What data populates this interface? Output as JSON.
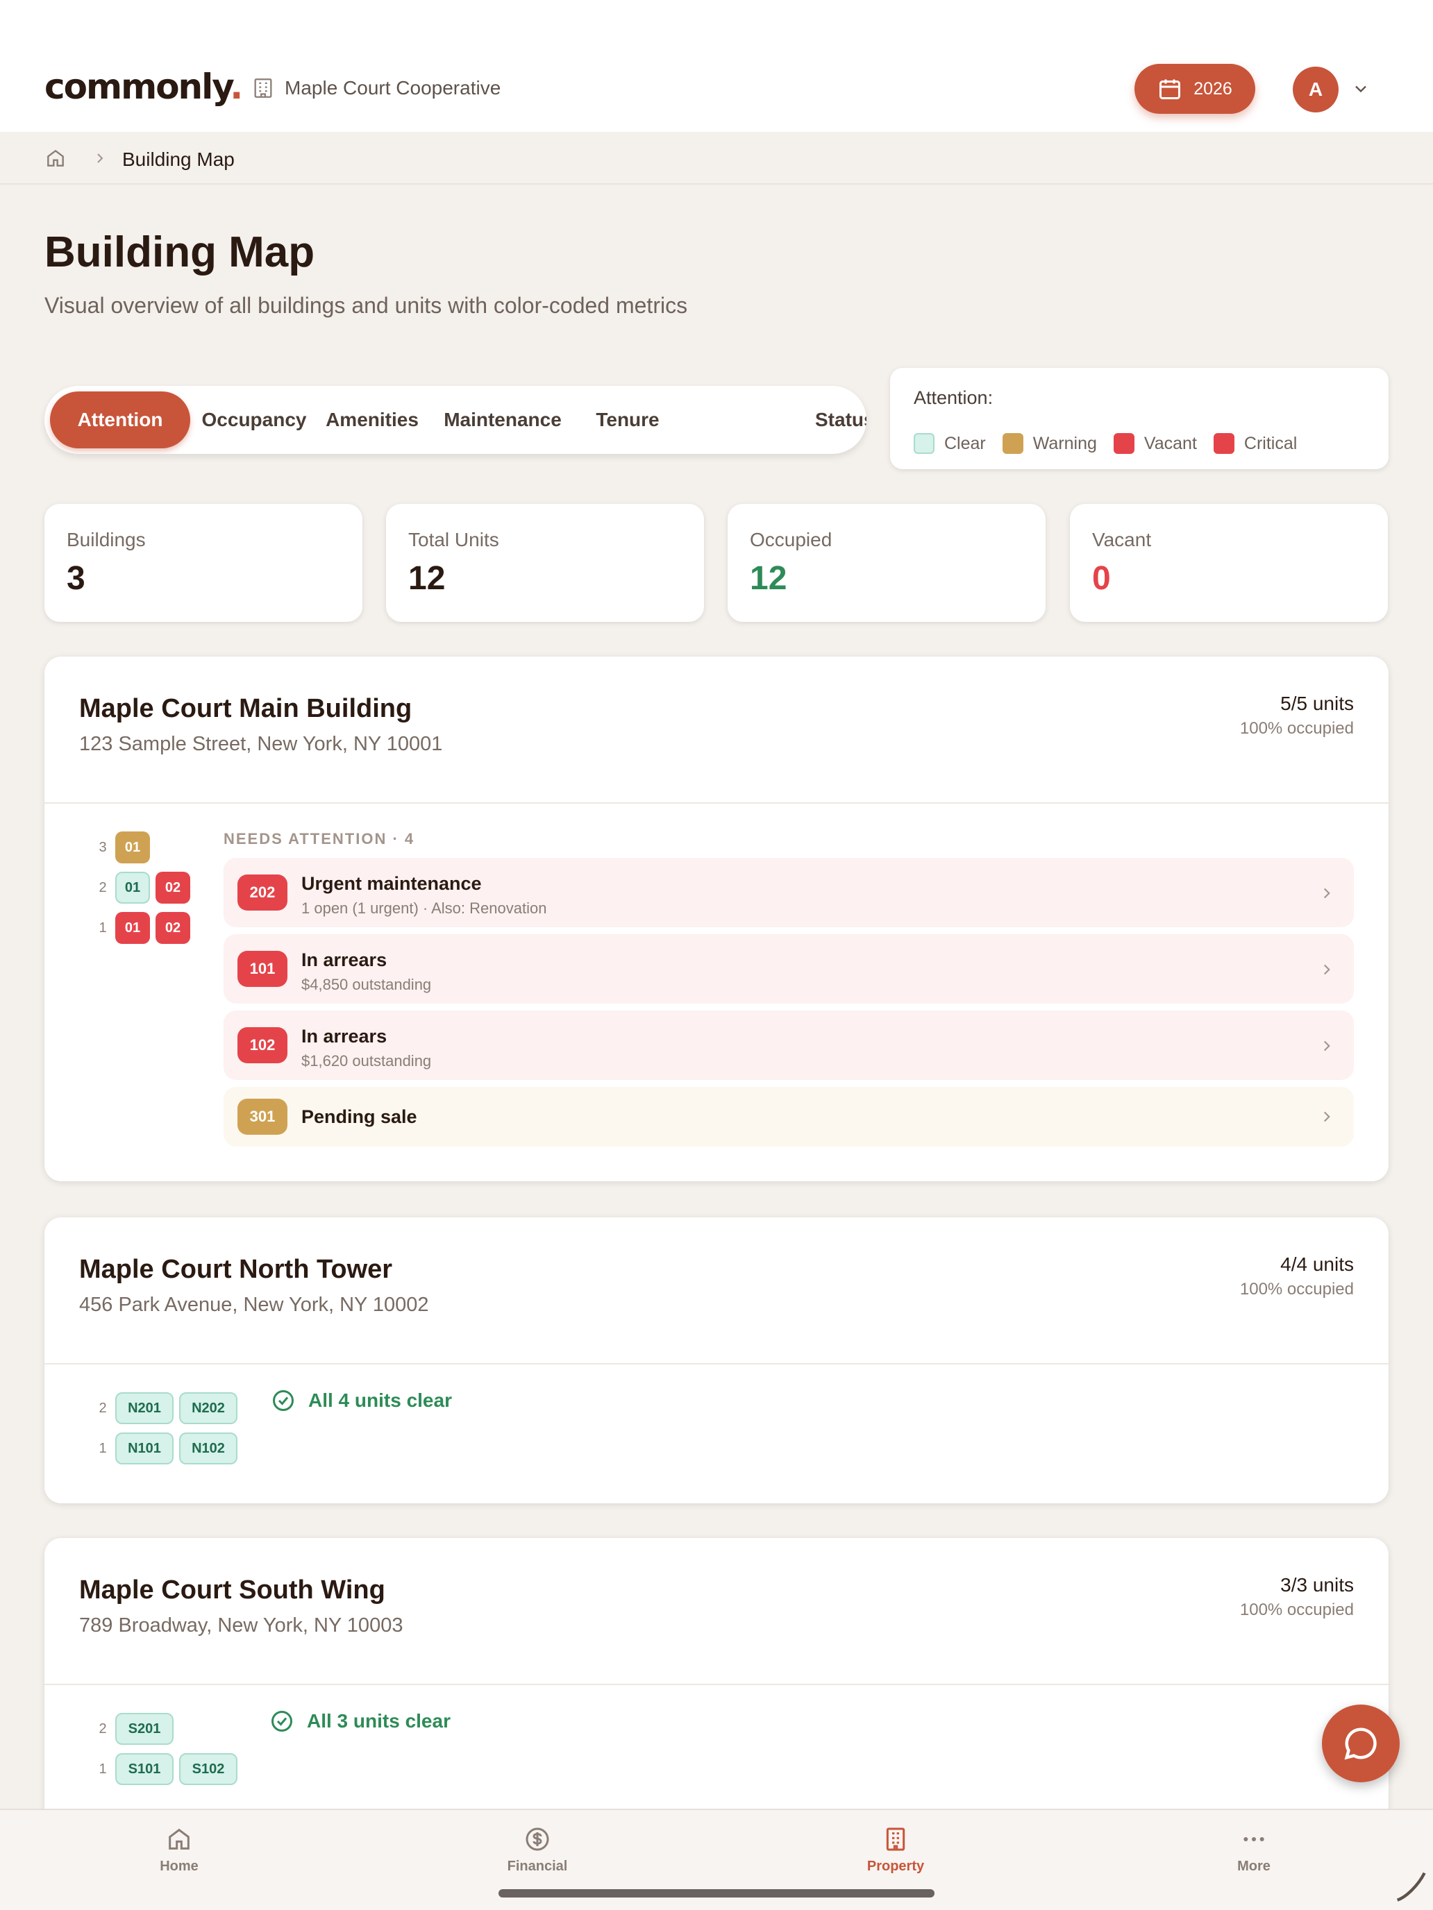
{
  "header": {
    "logo_text": "commonly",
    "logo_dot": ".",
    "org_name": "Maple Court Cooperative",
    "year_button": "2026",
    "avatar_initial": "A",
    "brand_color": "#c8553a"
  },
  "breadcrumb": {
    "current": "Building Map"
  },
  "page": {
    "title": "Building Map",
    "subtitle": "Visual overview of all buildings and units with color-coded metrics"
  },
  "tabs": [
    "Attention",
    "Occupancy",
    "Amenities",
    "Maintenance",
    "Tenure",
    "Status"
  ],
  "active_tab": "Attention",
  "legend": {
    "title": "Attention:",
    "items": [
      {
        "label": "Clear",
        "color": "#d6f2ea"
      },
      {
        "label": "Warning",
        "color": "#cfa253"
      },
      {
        "label": "Vacant",
        "color": "#e5434a"
      },
      {
        "label": "Critical",
        "color": "#e5434a"
      }
    ]
  },
  "stats": [
    {
      "label": "Buildings",
      "value": "3",
      "color": "#2a1a12"
    },
    {
      "label": "Total Units",
      "value": "12",
      "color": "#2a1a12"
    },
    {
      "label": "Occupied",
      "value": "12",
      "color": "#2e8b57"
    },
    {
      "label": "Vacant",
      "value": "0",
      "color": "#e5434a"
    }
  ],
  "buildings": [
    {
      "name": "Maple Court Main Building",
      "address": "123 Sample Street, New York, NY 10001",
      "units": "5/5 units",
      "occupied": "100% occupied",
      "floors": [
        {
          "floor": "3",
          "units": [
            {
              "label": "01",
              "status": "warning"
            }
          ]
        },
        {
          "floor": "2",
          "units": [
            {
              "label": "01",
              "status": "clear"
            },
            {
              "label": "02",
              "status": "critical"
            }
          ]
        },
        {
          "floor": "1",
          "units": [
            {
              "label": "01",
              "status": "critical"
            },
            {
              "label": "02",
              "status": "critical"
            }
          ]
        }
      ],
      "attention_label": "NEEDS ATTENTION · 4",
      "issues": [
        {
          "unit": "202",
          "title": "Urgent maintenance",
          "detail": "1 open (1 urgent) · Also: Renovation",
          "severity": "critical"
        },
        {
          "unit": "101",
          "title": "In arrears",
          "detail": "$4,850 outstanding",
          "severity": "critical"
        },
        {
          "unit": "102",
          "title": "In arrears",
          "detail": "$1,620 outstanding",
          "severity": "critical"
        },
        {
          "unit": "301",
          "title": "Pending sale",
          "detail": "",
          "severity": "warning"
        }
      ]
    },
    {
      "name": "Maple Court North Tower",
      "address": "456 Park Avenue, New York, NY 10002",
      "units": "4/4 units",
      "occupied": "100% occupied",
      "floors": [
        {
          "floor": "2",
          "units": [
            {
              "label": "N201",
              "status": "clear"
            },
            {
              "label": "N202",
              "status": "clear"
            }
          ]
        },
        {
          "floor": "1",
          "units": [
            {
              "label": "N101",
              "status": "clear"
            },
            {
              "label": "N102",
              "status": "clear"
            }
          ]
        }
      ],
      "clear_message": "All 4 units clear"
    },
    {
      "name": "Maple Court South Wing",
      "address": "789 Broadway, New York, NY 10003",
      "units": "3/3 units",
      "occupied": "100% occupied",
      "floors": [
        {
          "floor": "2",
          "units": [
            {
              "label": "S201",
              "status": "clear"
            }
          ]
        },
        {
          "floor": "1",
          "units": [
            {
              "label": "S101",
              "status": "clear"
            },
            {
              "label": "S102",
              "status": "clear"
            }
          ]
        }
      ],
      "clear_message": "All 3 units clear"
    }
  ],
  "bottom_nav": [
    {
      "label": "Home",
      "icon": "home-icon"
    },
    {
      "label": "Financial",
      "icon": "dollar-icon"
    },
    {
      "label": "Property",
      "icon": "building-icon",
      "active": true
    },
    {
      "label": "More",
      "icon": "more-icon"
    }
  ]
}
